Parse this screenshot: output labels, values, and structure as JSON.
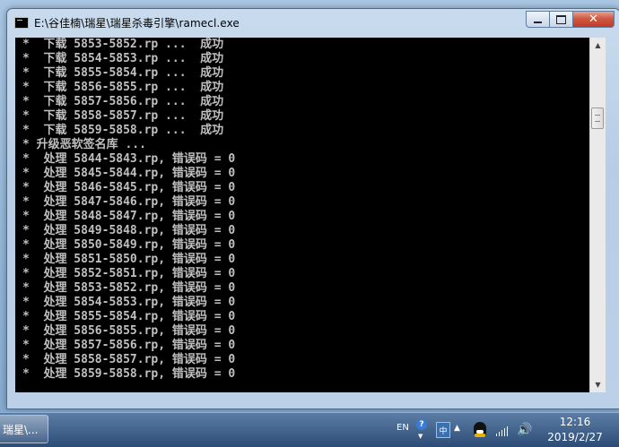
{
  "window": {
    "title": "E:\\谷佳楠\\瑞星\\瑞星杀毒引擎\\ramecl.exe",
    "buttons": {
      "minimize": "—",
      "maximize": "□",
      "close": "✕"
    }
  },
  "console": {
    "lines": [
      "*  下载 5853-5852.rp ...  成功",
      "*  下载 5854-5853.rp ...  成功",
      "*  下载 5855-5854.rp ...  成功",
      "*  下载 5856-5855.rp ...  成功",
      "*  下载 5857-5856.rp ...  成功",
      "*  下载 5858-5857.rp ...  成功",
      "*  下载 5859-5858.rp ...  成功",
      "* 升级恶软签名库 ...",
      "*  处理 5844-5843.rp, 错误码 = 0",
      "*  处理 5845-5844.rp, 错误码 = 0",
      "*  处理 5846-5845.rp, 错误码 = 0",
      "*  处理 5847-5846.rp, 错误码 = 0",
      "*  处理 5848-5847.rp, 错误码 = 0",
      "*  处理 5849-5848.rp, 错误码 = 0",
      "*  处理 5850-5849.rp, 错误码 = 0",
      "*  处理 5851-5850.rp, 错误码 = 0",
      "*  处理 5852-5851.rp, 错误码 = 0",
      "*  处理 5853-5852.rp, 错误码 = 0",
      "*  处理 5854-5853.rp, 错误码 = 0",
      "*  处理 5855-5854.rp, 错误码 = 0",
      "*  处理 5856-5855.rp, 错误码 = 0",
      "*  处理 5857-5856.rp, 错误码 = 0",
      "*  处理 5858-5857.rp, 错误码 = 0",
      "*  处理 5859-5858.rp, 错误码 = 0"
    ]
  },
  "scrollbar": {
    "up_arrow": "▲",
    "down_arrow": "▼"
  },
  "taskbar": {
    "task_label": "瑞星\\...",
    "tray": {
      "language": "EN",
      "help": "?",
      "ime_arrow": "▼",
      "ime": "中",
      "expand": "▲",
      "volume": "🔊"
    },
    "clock": {
      "time": "12:16",
      "date": "2019/2/27"
    }
  }
}
